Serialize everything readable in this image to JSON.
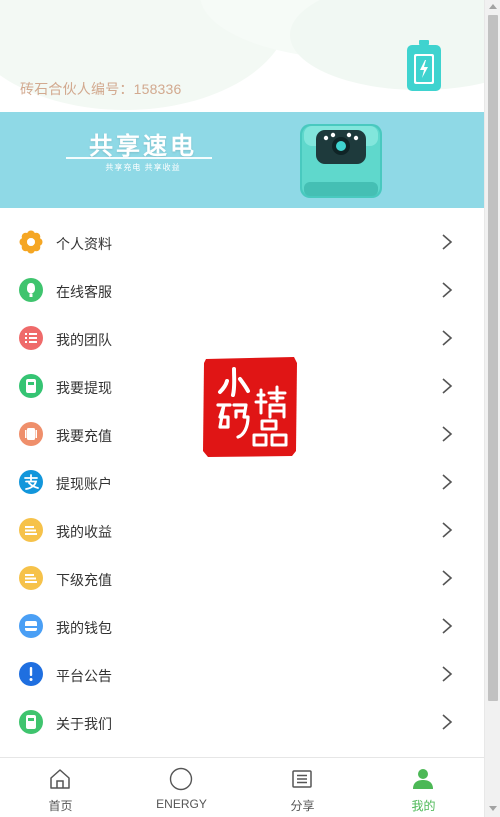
{
  "header": {
    "partner_id_text": "砖石合伙人编号：158336",
    "battery_icon": "battery-charging-icon",
    "accent_color": "#3fd3cf"
  },
  "banner": {
    "title": "共享速电",
    "subtitle": "共享充电 共享收益",
    "background_color": "#8fd9e6"
  },
  "menu": {
    "items": [
      {
        "label": "个人资料",
        "icon": "profile-flower-icon",
        "color": "#f5a623"
      },
      {
        "label": "在线客服",
        "icon": "customer-service-icon",
        "color": "#3fc46e"
      },
      {
        "label": "我的团队",
        "icon": "team-list-icon",
        "color": "#ef6a6a"
      },
      {
        "label": "我要提现",
        "icon": "withdraw-icon",
        "color": "#35c473"
      },
      {
        "label": "我要充值",
        "icon": "recharge-icon",
        "color": "#ef8f6b"
      },
      {
        "label": "提现账户",
        "icon": "alipay-icon",
        "color": "#1296db"
      },
      {
        "label": "我的收益",
        "icon": "earnings-icon",
        "color": "#f6c24a"
      },
      {
        "label": "下级充值",
        "icon": "sub-recharge-icon",
        "color": "#f6c24a"
      },
      {
        "label": "我的钱包",
        "icon": "wallet-icon",
        "color": "#4a9ff5"
      },
      {
        "label": "平台公告",
        "icon": "announcement-icon",
        "color": "#1f6fe0"
      },
      {
        "label": "关于我们",
        "icon": "about-us-icon",
        "color": "#3fc46e"
      }
    ]
  },
  "stamp": {
    "text": "小码精品",
    "color": "#e01515"
  },
  "tabbar": {
    "tabs": [
      {
        "label": "首页",
        "icon": "home-icon",
        "active": false
      },
      {
        "label": "ENERGY",
        "icon": "energy-circle-icon",
        "active": false
      },
      {
        "label": "分享",
        "icon": "share-list-icon",
        "active": false
      },
      {
        "label": "我的",
        "icon": "user-icon",
        "active": true
      }
    ],
    "active_color": "#4cb856"
  }
}
